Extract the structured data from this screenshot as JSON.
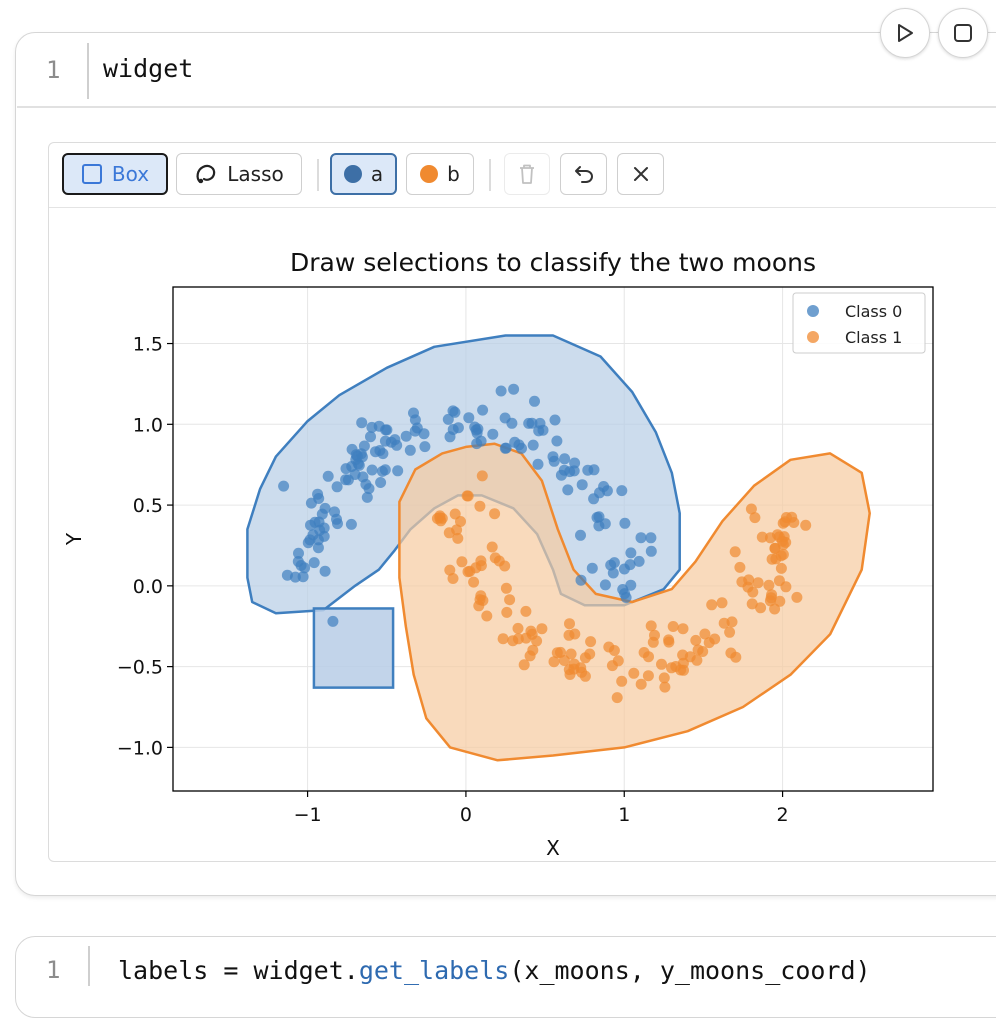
{
  "cell": {
    "line_number": "1",
    "code": "widget"
  },
  "toolbar": {
    "box_label": "Box",
    "lasso_label": "Lasso",
    "class_a_label": "a",
    "class_b_label": "b",
    "active_tool": "box",
    "active_class": "a"
  },
  "colors": {
    "class0": "#3f7fbf",
    "class1": "#f08a30",
    "selection_a_fill": "#b7cde6",
    "selection_b_fill": "#f7caa0"
  },
  "chart_data": {
    "type": "scatter",
    "title": "Draw selections to classify the two moons",
    "xlabel": "X",
    "ylabel": "Y",
    "xlim": [
      -1.85,
      2.95
    ],
    "ylim": [
      -1.27,
      1.85
    ],
    "xticks": [
      -1,
      0,
      1,
      2
    ],
    "yticks": [
      -1.0,
      -0.5,
      0.0,
      0.5,
      1.0,
      1.5
    ],
    "grid": true,
    "legend_position": "upper-right",
    "series": [
      {
        "name": "Class 0",
        "shape": "moon-upper",
        "n": 150,
        "noise": 0.1
      },
      {
        "name": "Class 1",
        "shape": "moon-lower",
        "n": 150,
        "noise": 0.1
      }
    ],
    "extra_points": [
      {
        "x": -0.84,
        "y": -0.22,
        "class": 0
      }
    ],
    "selections": [
      {
        "class": "a",
        "tool": "lasso",
        "polygon": [
          [
            -1.38,
            0.05
          ],
          [
            -1.38,
            0.35
          ],
          [
            -1.3,
            0.6
          ],
          [
            -1.2,
            0.8
          ],
          [
            -1.0,
            1.02
          ],
          [
            -0.8,
            1.18
          ],
          [
            -0.5,
            1.35
          ],
          [
            -0.2,
            1.48
          ],
          [
            0.25,
            1.55
          ],
          [
            0.55,
            1.55
          ],
          [
            0.85,
            1.42
          ],
          [
            1.05,
            1.2
          ],
          [
            1.2,
            0.95
          ],
          [
            1.3,
            0.7
          ],
          [
            1.35,
            0.45
          ],
          [
            1.35,
            0.1
          ],
          [
            1.25,
            -0.02
          ],
          [
            1.0,
            -0.12
          ],
          [
            0.75,
            -0.12
          ],
          [
            0.6,
            -0.05
          ],
          [
            0.55,
            0.1
          ],
          [
            0.45,
            0.32
          ],
          [
            0.3,
            0.48
          ],
          [
            0.1,
            0.56
          ],
          [
            -0.05,
            0.56
          ],
          [
            -0.2,
            0.48
          ],
          [
            -0.35,
            0.35
          ],
          [
            -0.45,
            0.22
          ],
          [
            -0.55,
            0.1
          ],
          [
            -0.7,
            0.0
          ],
          [
            -0.9,
            -0.15
          ],
          [
            -1.2,
            -0.17
          ],
          [
            -1.35,
            -0.1
          ]
        ]
      },
      {
        "class": "a",
        "tool": "box",
        "rect": [
          -0.96,
          -0.63,
          -0.46,
          -0.14
        ]
      },
      {
        "class": "b",
        "tool": "lasso",
        "polygon": [
          [
            -0.42,
            0.05
          ],
          [
            -0.42,
            0.52
          ],
          [
            -0.32,
            0.72
          ],
          [
            -0.15,
            0.82
          ],
          [
            0.0,
            0.86
          ],
          [
            0.18,
            0.88
          ],
          [
            0.35,
            0.82
          ],
          [
            0.48,
            0.65
          ],
          [
            0.58,
            0.35
          ],
          [
            0.68,
            0.1
          ],
          [
            0.82,
            -0.05
          ],
          [
            1.05,
            -0.1
          ],
          [
            1.3,
            -0.02
          ],
          [
            1.45,
            0.15
          ],
          [
            1.62,
            0.4
          ],
          [
            1.82,
            0.62
          ],
          [
            2.05,
            0.78
          ],
          [
            2.3,
            0.82
          ],
          [
            2.5,
            0.7
          ],
          [
            2.55,
            0.45
          ],
          [
            2.5,
            0.1
          ],
          [
            2.3,
            -0.3
          ],
          [
            2.05,
            -0.55
          ],
          [
            1.75,
            -0.75
          ],
          [
            1.4,
            -0.9
          ],
          [
            1.0,
            -1.0
          ],
          [
            0.55,
            -1.05
          ],
          [
            0.2,
            -1.08
          ],
          [
            -0.1,
            -1.0
          ],
          [
            -0.25,
            -0.82
          ],
          [
            -0.33,
            -0.55
          ],
          [
            -0.38,
            -0.25
          ]
        ]
      }
    ]
  },
  "next_cell": {
    "line_number": "1",
    "code_prefix": "labels = widget.",
    "code_method": "get_labels",
    "code_suffix": "(x_moons, y_moons_coord)"
  }
}
